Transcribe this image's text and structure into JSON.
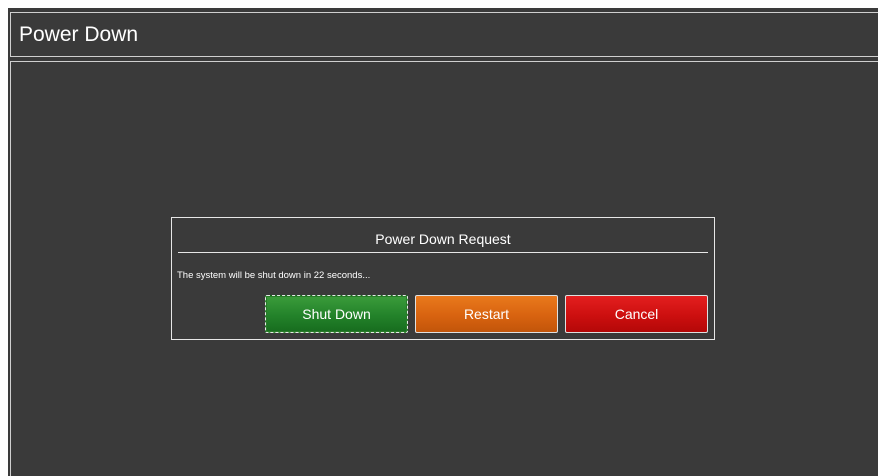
{
  "header": {
    "title": "Power Down"
  },
  "dialog": {
    "title": "Power Down Request",
    "message": "The system will be shut down in 22 seconds...",
    "countdown_seconds": 22,
    "buttons": {
      "shutdown_label": "Shut Down",
      "restart_label": "Restart",
      "cancel_label": "Cancel"
    }
  },
  "colors": {
    "background": "#3a3a3a",
    "border": "#cfcfcf",
    "shutdown": "#23822a",
    "restart": "#d86310",
    "cancel": "#cc0f0f"
  }
}
